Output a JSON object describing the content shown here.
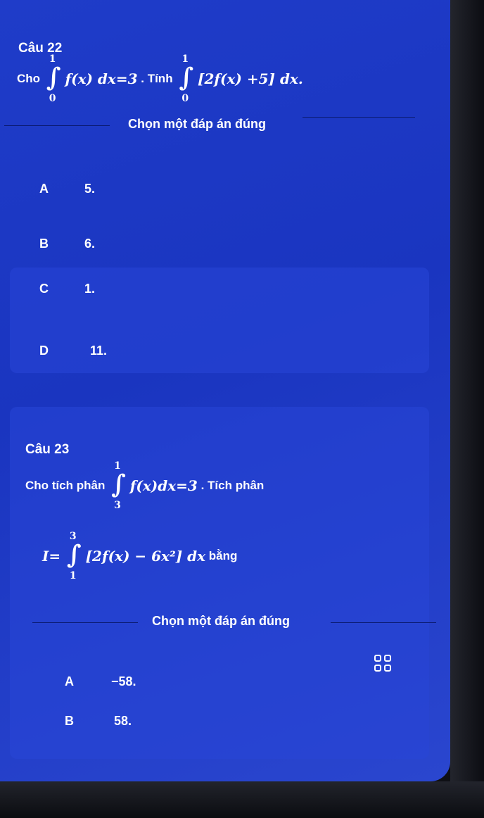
{
  "q22": {
    "title": "Câu 22",
    "prompt_pre": "Cho",
    "int1": {
      "upper": "1",
      "lower": "0",
      "body": "f(x) dx=3"
    },
    "prompt_mid": ". Tính",
    "int2": {
      "upper": "1",
      "lower": "0",
      "body": "[2f(x) +5] dx."
    },
    "choose_label": "Chọn một đáp án đúng",
    "options": [
      {
        "letter": "A",
        "value": "5."
      },
      {
        "letter": "B",
        "value": "6."
      },
      {
        "letter": "C",
        "value": "1."
      },
      {
        "letter": "D",
        "value": "11."
      }
    ]
  },
  "q23": {
    "title": "Câu 23",
    "prompt_pre": "Cho tích phân",
    "int1": {
      "upper": "1",
      "lower": "3",
      "body": "f(x)dx=3"
    },
    "prompt_mid": ". Tích phân",
    "line2_pre": "I=",
    "int2": {
      "upper": "3",
      "lower": "1",
      "body": "[2f(x) − 6x²] dx"
    },
    "line2_post": "bằng",
    "choose_label": "Chọn một đáp án đúng",
    "options": [
      {
        "letter": "A",
        "value": "−58."
      },
      {
        "letter": "B",
        "value": "58."
      }
    ]
  },
  "colors": {
    "screen": "#1f3cc9",
    "card": "#2846d7",
    "divider": "#0a1a70"
  },
  "icons": {
    "grid": "grid-icon"
  }
}
